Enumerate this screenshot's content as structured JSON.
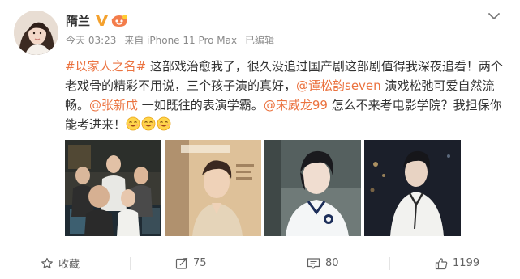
{
  "post": {
    "author": "隋兰",
    "meta": {
      "time": "今天 03:23",
      "source": "来自 iPhone 11 Pro Max",
      "edited": "已编辑"
    },
    "content": {
      "line1": {
        "hashtag": "#以家人之名#",
        "text": " 这部戏治愈我了，很久没追过国产剧这部剧值得我深夜追看！两个"
      },
      "line2": {
        "text_a": "老戏骨的精彩不用说，三个孩子演的真好，",
        "mention": "@谭松韵seven",
        "text_b": " 演戏松弛可爱自然流"
      },
      "line3": {
        "text_a": "畅。",
        "mention_a": "@张新成",
        "text_b": " 一如既往的表演学霸。",
        "mention_b": "@宋威龙99",
        "text_c": " 怎么不来考电影学院？我担保你"
      },
      "line4": {
        "text": "能考进来！"
      },
      "emojis": [
        "grin-emoji",
        "grin-emoji",
        "grin-emoji"
      ]
    },
    "images": [
      "cast-group-photo",
      "actor-portrait-warm",
      "actor-school-uniform",
      "actor-night-portrait"
    ]
  },
  "actions": {
    "favorite_label": "收藏",
    "repost_count": "75",
    "comment_count": "80",
    "like_count": "1199"
  },
  "colors": {
    "link": "#eb7340",
    "text": "#333333",
    "meta": "#8a8a8a",
    "vip": "#f4a12e"
  }
}
